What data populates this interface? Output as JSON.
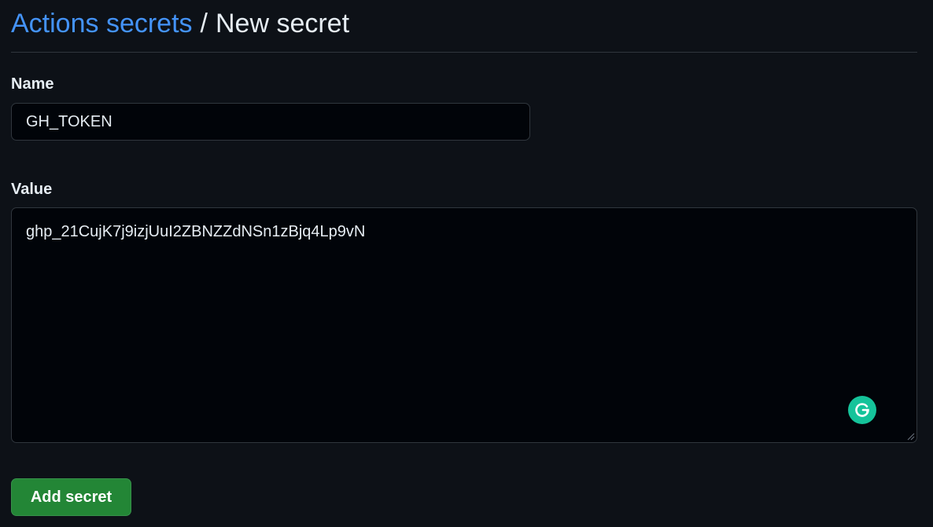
{
  "breadcrumb": {
    "parent_label": "Actions secrets",
    "separator": "/",
    "current_label": "New secret"
  },
  "form": {
    "name_label": "Name",
    "name_value": "GH_TOKEN",
    "value_label": "Value",
    "value_value": "ghp_21CujK7j9izjUuI2ZBNZZdNSn1zBjq4Lp9vN",
    "submit_label": "Add secret"
  },
  "icons": {
    "grammarly": "grammarly-icon",
    "resize": "resize-handle-icon"
  },
  "colors": {
    "background": "#0d1117",
    "link": "#4493f8",
    "primary_button": "#238636",
    "grammarly": "#15c39a"
  }
}
